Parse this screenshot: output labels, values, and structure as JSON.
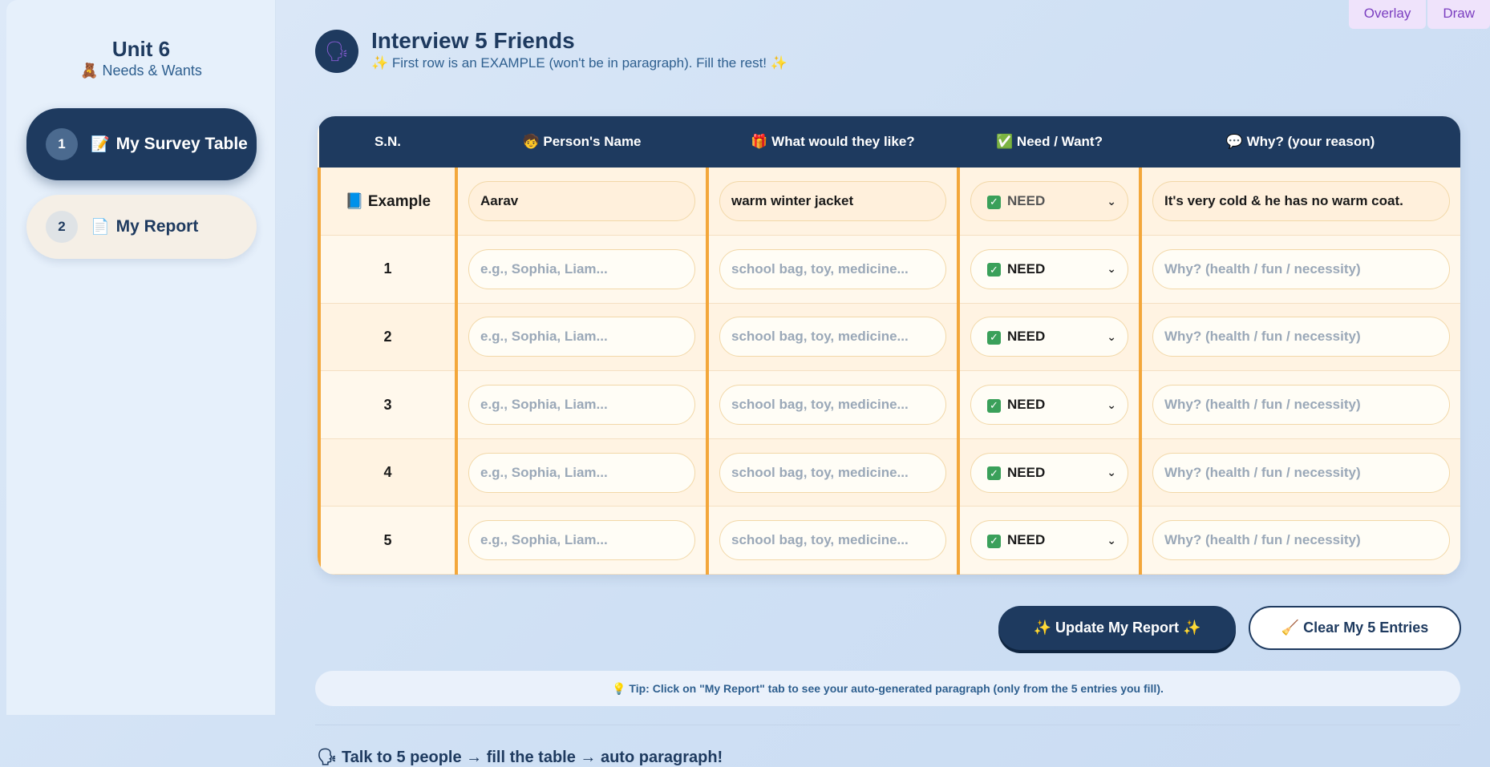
{
  "tools": {
    "overlay": "Overlay",
    "draw": "Draw"
  },
  "sidebar": {
    "unit_title": "Unit 6",
    "unit_subtitle": "🧸 Needs & Wants",
    "items": [
      {
        "num": "1",
        "icon": "📝",
        "label": "My Survey Table"
      },
      {
        "num": "2",
        "icon": "📄",
        "label": "My Report"
      }
    ]
  },
  "header": {
    "avatar_icon": "🗣",
    "title": "Interview 5 Friends",
    "subtitle": "✨ First row is an EXAMPLE (won't be in paragraph). Fill the rest! ✨"
  },
  "table": {
    "headers": [
      "S.N.",
      "🧒 Person's Name",
      "🎁 What would they like?",
      "✅ Need / Want?",
      "💬 Why? (your reason)"
    ],
    "example": {
      "sn": "📘 Example",
      "name": "Aarav",
      "item": "warm winter jacket",
      "choice": "NEED",
      "reason": "It's very cold & he has no warm coat."
    },
    "placeholders": {
      "name": "e.g., Sophia, Liam...",
      "item": "school bag, toy, medicine...",
      "reason": "Why? (health / fun / necessity)"
    },
    "rows": [
      {
        "sn": "1",
        "choice": "NEED"
      },
      {
        "sn": "2",
        "choice": "NEED"
      },
      {
        "sn": "3",
        "choice": "NEED"
      },
      {
        "sn": "4",
        "choice": "NEED"
      },
      {
        "sn": "5",
        "choice": "NEED"
      }
    ]
  },
  "buttons": {
    "update": "✨ Update My Report ✨",
    "clear": "🧹 Clear My 5 Entries"
  },
  "tip": "💡 Tip: Click on \"My Report\" tab to see your auto-generated paragraph (only from the 5 entries you fill).",
  "footer": "🗣 Talk to 5 people → fill the table → auto paragraph!",
  "colors": {
    "navy": "#1e3a5f",
    "orange_border": "#f3a73b",
    "cream": "#fff3e2"
  }
}
